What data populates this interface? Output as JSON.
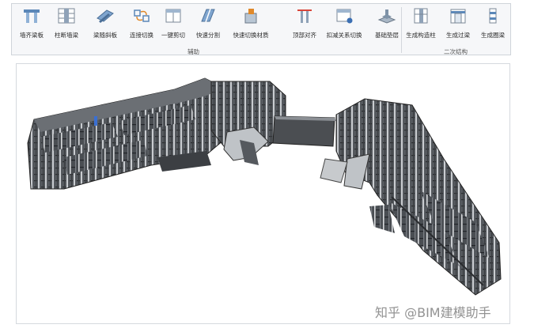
{
  "ribbon": {
    "groups": [
      {
        "label": "辅助"
      },
      {
        "label": "二次结构"
      }
    ],
    "tools": [
      {
        "label": "墙齐梁板",
        "icon": "wall-align-beam-icon"
      },
      {
        "label": "柱断墙梁",
        "icon": "column-cut-wall-icon"
      },
      {
        "label": "梁随斜板",
        "icon": "beam-follow-slab-icon"
      },
      {
        "label": "连接切换",
        "icon": "connect-switch-icon"
      },
      {
        "label": "一键剪切",
        "icon": "one-click-cut-icon"
      },
      {
        "label": "快速分割",
        "icon": "quick-split-icon"
      },
      {
        "label": "快速切换材质",
        "icon": "quick-material-switch-icon"
      },
      {
        "label": "顶部对齐",
        "icon": "top-align-icon"
      },
      {
        "label": "扣减关系切换",
        "icon": "deduction-switch-icon"
      },
      {
        "label": "基础垫层",
        "icon": "foundation-cushion-icon"
      },
      {
        "label": "生成构造柱",
        "icon": "generate-column-icon"
      },
      {
        "label": "生成过梁",
        "icon": "generate-lintel-icon"
      },
      {
        "label": "生成圈梁",
        "icon": "generate-ring-beam-icon"
      }
    ]
  },
  "watermark": "知乎 @BIM建模助手"
}
